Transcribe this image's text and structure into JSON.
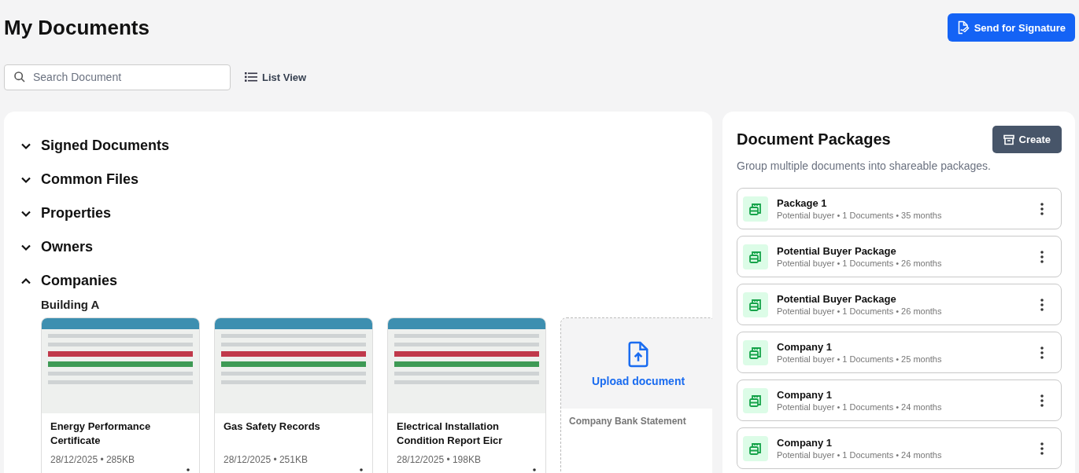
{
  "page": {
    "title": "My Documents",
    "send_button": "Send for Signature"
  },
  "search": {
    "placeholder": "Search Document"
  },
  "view_toggle": {
    "label": "List View"
  },
  "sections": [
    {
      "title": "Signed Documents",
      "expanded": false
    },
    {
      "title": "Common Files",
      "expanded": false
    },
    {
      "title": "Properties",
      "expanded": false
    },
    {
      "title": "Owners",
      "expanded": false
    },
    {
      "title": "Companies",
      "expanded": true,
      "group": "Building A",
      "documents": [
        {
          "kind": "document",
          "title": "Energy Performance Certificate",
          "meta": "28/12/2025 • 285KB"
        },
        {
          "kind": "document",
          "title": "Gas Safety Records",
          "meta": "28/12/2025 • 251KB"
        },
        {
          "kind": "document",
          "title": "Electrical Installation Condition Report Eicr",
          "meta": "28/12/2025 • 198KB"
        },
        {
          "kind": "upload",
          "action": "Upload document",
          "title": "Company Bank Statement"
        }
      ]
    }
  ],
  "packages": {
    "title": "Document Packages",
    "create_button": "Create",
    "subtitle": "Group multiple documents into shareable packages.",
    "items": [
      {
        "name": "Package 1",
        "meta": "Potential buyer • 1 Documents • 35 months"
      },
      {
        "name": "Potential Buyer Package",
        "meta": "Potential buyer • 1 Documents • 26 months"
      },
      {
        "name": "Potential Buyer Package",
        "meta": "Potential buyer • 1 Documents • 26 months"
      },
      {
        "name": "Company 1",
        "meta": "Potential buyer • 1 Documents • 25 months"
      },
      {
        "name": "Company 1",
        "meta": "Potential buyer • 1 Documents • 24 months"
      },
      {
        "name": "Company 1",
        "meta": "Potential buyer • 1 Documents • 24 months"
      }
    ]
  }
}
